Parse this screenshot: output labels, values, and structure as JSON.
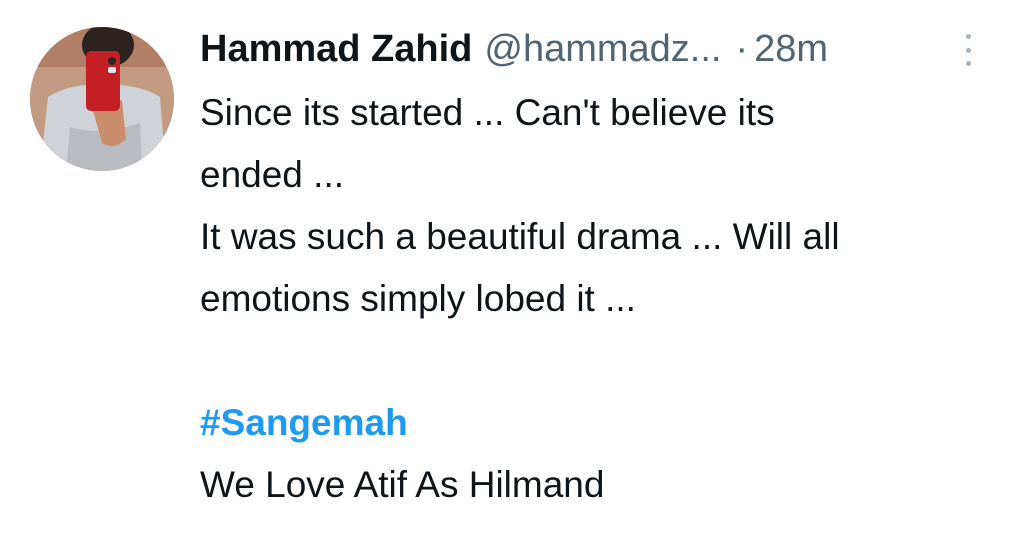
{
  "author": {
    "display_name": "Hammad Zahid",
    "handle": "@hammadz...",
    "separator": "·",
    "time": "28m"
  },
  "icons": {
    "avatar": "user-avatar-photo",
    "more": "more-options-icon"
  },
  "tweet": {
    "line1": "Since its started ... Can't believe its",
    "line2": "ended ...",
    "line3": "It was such a beautiful drama ... Will all",
    "line4": "emotions simply lobed it ...",
    "hashtag": "#Sangemah",
    "line5": "We Love Atif As Hilmand"
  },
  "colors": {
    "text": "#0f1419",
    "secondary": "#536471",
    "link": "#1d9bf0"
  }
}
